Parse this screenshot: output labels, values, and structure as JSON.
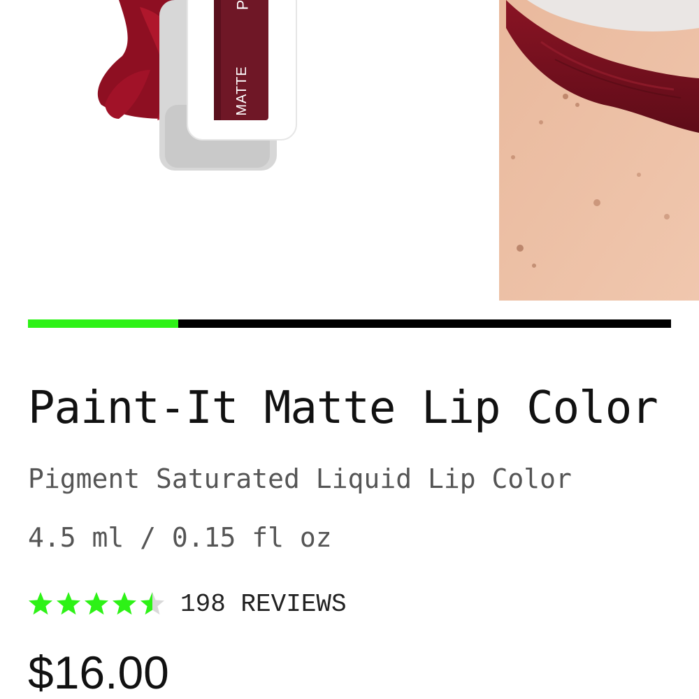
{
  "gallery": {
    "tube_label": "MATTE",
    "tube_cap_letter": "P",
    "progress_fraction": 0.234
  },
  "product": {
    "title": "Paint-It Matte Lip Color",
    "subtitle": "Pigment Saturated Liquid Lip Color",
    "size": "4.5 ml / 0.15 fl oz",
    "rating": 4.5,
    "max_rating": 5,
    "reviews_label": "198 REVIEWS",
    "price": "$16.00"
  },
  "colors": {
    "accent_green": "#2df216",
    "track_black": "#000000",
    "lip_red": "#7a1020",
    "star_empty": "#d9d9d9"
  }
}
